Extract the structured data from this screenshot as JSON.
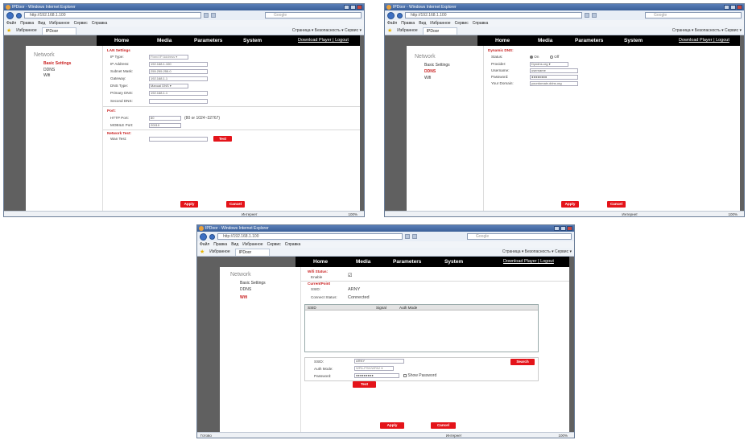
{
  "window_title": "IPDoor - Windows Internet Explorer",
  "url": "http://192.168.1.100",
  "search_placeholder": "Google",
  "menu": [
    "Файл",
    "Правка",
    "Вид",
    "Избранное",
    "Сервис",
    "Справка"
  ],
  "favorites_label": "Избранное",
  "tab_title": "IPDoor",
  "toolbar_right": "Страница ▾  Безопасность ▾  Сервис ▾",
  "nav": {
    "home": "Home",
    "media": "Media",
    "parameters": "Parameters",
    "system": "System",
    "download": "Download Player | Logout"
  },
  "sidebar": {
    "title": "Network",
    "items": [
      "Basic Settings",
      "DDNS",
      "Wifi"
    ]
  },
  "basic": {
    "lan_title": "LAN Settings",
    "ip_type_label": "IP Type:",
    "ip_type_value": "Fixed IP Address ▾",
    "ip_label": "IP Address:",
    "ip_value": "192.168.1.100",
    "mask_label": "Subnet Mask:",
    "mask_value": "255.255.255.0",
    "gw_label": "Gateway:",
    "gw_value": "192.168.1.1",
    "dns_type_label": "DNS Type:",
    "dns_type_value": "Manual DNS ▾",
    "dns1_label": "Primary DNS:",
    "dns1_value": "192.168.1.1",
    "dns2_label": "Second DNS:",
    "dns2_value": "",
    "port_title": "Port:",
    "http_label": "HTTP Port:",
    "http_value": "80",
    "http_hint": "(80 or 1024~32767)",
    "mobile_label": "MOBILE Port:",
    "mobile_value": "20010",
    "test_title": "Network Test:",
    "wan_label": "Wan Test:",
    "wan_value": "",
    "test_btn": "Test"
  },
  "ddns": {
    "title": "Dynamic DNS:",
    "status_label": "Status:",
    "on": "On",
    "off": "Off",
    "provider_label": "Provider:",
    "provider_value": "Dyndns.org ▾",
    "user_label": "Username:",
    "user_value": "username",
    "pass_label": "Password:",
    "pass_value": "●●●●●●●●",
    "domain_label": "Your Domain:",
    "domain_value": "yourdomain.ddns.org"
  },
  "wifi": {
    "status_title": "Wifi Status:",
    "enable_label": "Enable",
    "enable_check": "☑",
    "current_title": "CurrentPoint",
    "ssid_label": "SSID:",
    "ssid_value": "ARNY",
    "connect_label": "Connect Status:",
    "connect_value": "Connected",
    "col_ssid": "SSID",
    "col_signal": "Signal",
    "col_auth": "Auth Mode",
    "form_ssid_label": "SSID:",
    "form_ssid_value": "ARNY",
    "auth_label": "Auth Mode:",
    "auth_value": "WPA-PSK/WPA2 ▾",
    "pass_label": "Password:",
    "pass_value": "●●●●●●●●●",
    "show_pass": "Show Password",
    "search_btn": "Search",
    "test_btn": "Test"
  },
  "apply": "Apply",
  "cancel": "Cancel",
  "status_inet": "Интернет",
  "status_zoom": "100%",
  "status_left": "Готово"
}
